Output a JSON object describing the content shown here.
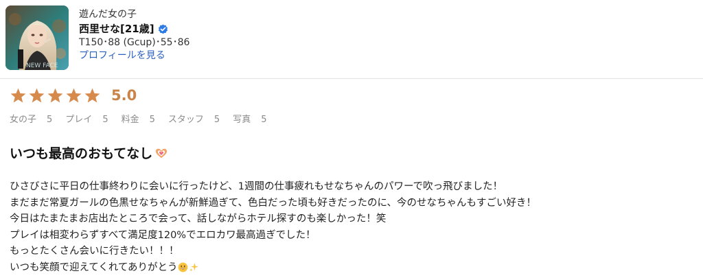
{
  "profile": {
    "label": "遊んだ女の子",
    "name": "西里せな[21歳]",
    "stats": "T150･88 (Gcup)･55･86",
    "link": "プロフィールを見る"
  },
  "rating": {
    "stars": 5,
    "score": "5.0",
    "sub": [
      {
        "label": "女の子",
        "value": "5"
      },
      {
        "label": "プレイ",
        "value": "5"
      },
      {
        "label": "料金",
        "value": "5"
      },
      {
        "label": "スタッフ",
        "value": "5"
      },
      {
        "label": "写真",
        "value": "5"
      }
    ]
  },
  "review": {
    "title": "いつも最高のおもてなし",
    "lines": [
      "ひさびさに平日の仕事終わりに会いに行ったけど、1週間の仕事疲れもせなちゃんのパワーで吹っ飛びました！",
      "まだまだ常夏ガールの色黒せなちゃんが新鮮過ぎて、色白だった頃も好きだったのに、今のせなちゃんもすごい好き！",
      "今日はたまたまお店出たところで会って、話しながらホテル探すのも楽しかった！笑",
      "プレイは相変わらずすべて満足度120%でエロカワ最高過ぎでした！",
      "もっとたくさん会いに行きたい！！！",
      "いつも笑顔で迎えてくれてありがとう"
    ]
  },
  "colors": {
    "star": "#d68a4c",
    "score": "#c9844a",
    "link": "#2b5fbf",
    "verified": "#2d7be5"
  },
  "icons": [
    "verified-badge-icon",
    "star-icon",
    "heart-hands-icon",
    "grinning-face-icon",
    "sparkles-icon"
  ]
}
